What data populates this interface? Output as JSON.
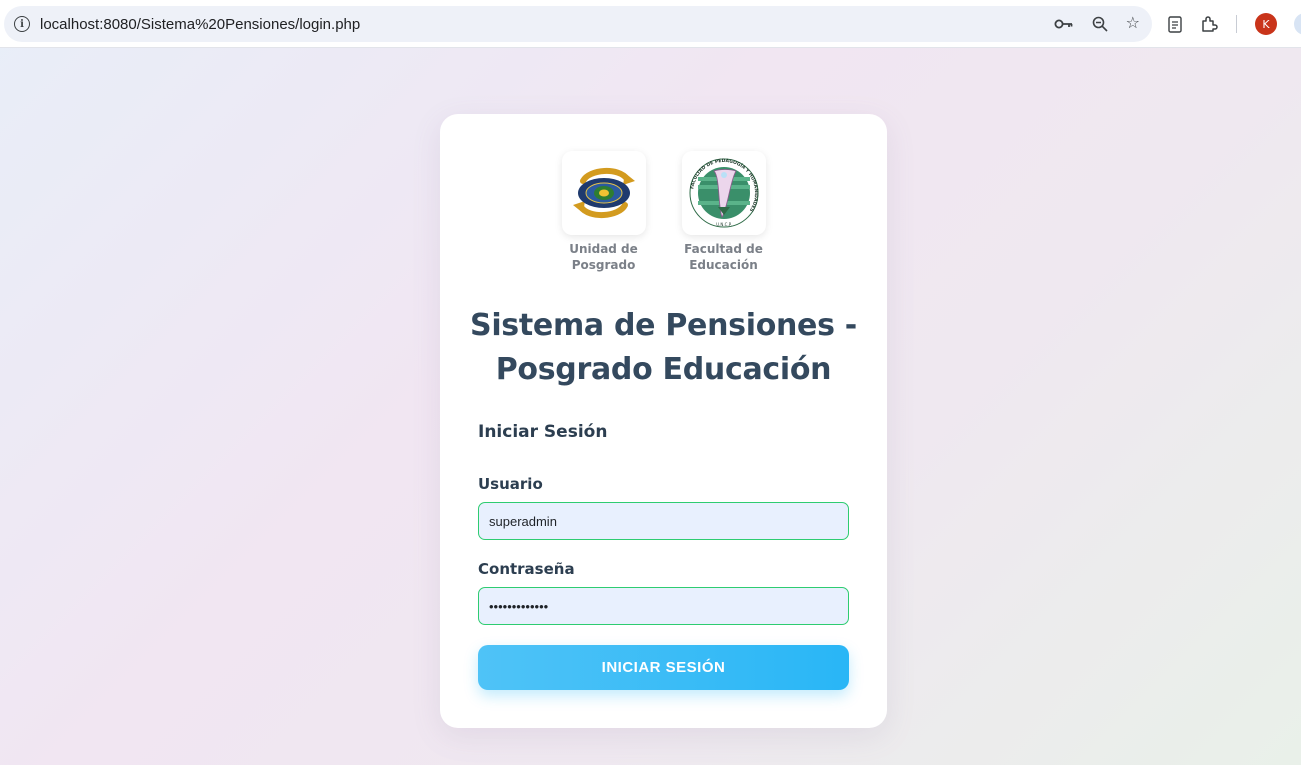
{
  "browser": {
    "url": "localhost:8080/Sistema%20Pensiones/login.php",
    "icons": [
      "info-icon",
      "key-icon",
      "zoom-out-icon",
      "star-icon",
      "document-icon",
      "extensions-icon",
      "profile-avatar"
    ],
    "avatar_letter": "K",
    "avatar_color": "#c9341a"
  },
  "logos": [
    {
      "caption": "Unidad de Posgrado",
      "icon": "unidad-posgrado-logo"
    },
    {
      "caption": "Facultad de Educación",
      "icon": "facultad-educacion-logo",
      "ring_text": "FACULTAD DE PEDAGOGÍA Y HUMANIDADES",
      "bottom_text": "U.N.C.P."
    }
  ],
  "title": "Sistema de Pensiones - Posgrado Educación",
  "form": {
    "heading": "Iniciar Sesión",
    "user_label": "Usuario",
    "user_value": "superadmin",
    "password_label": "Contraseña",
    "password_value": "•••••••••••••",
    "submit_label": "INICIAR SESIÓN"
  },
  "colors": {
    "accent": "#29b6f6",
    "input_border": "#2ecc71",
    "input_bg": "#e8f0fe",
    "title": "#34495e"
  }
}
